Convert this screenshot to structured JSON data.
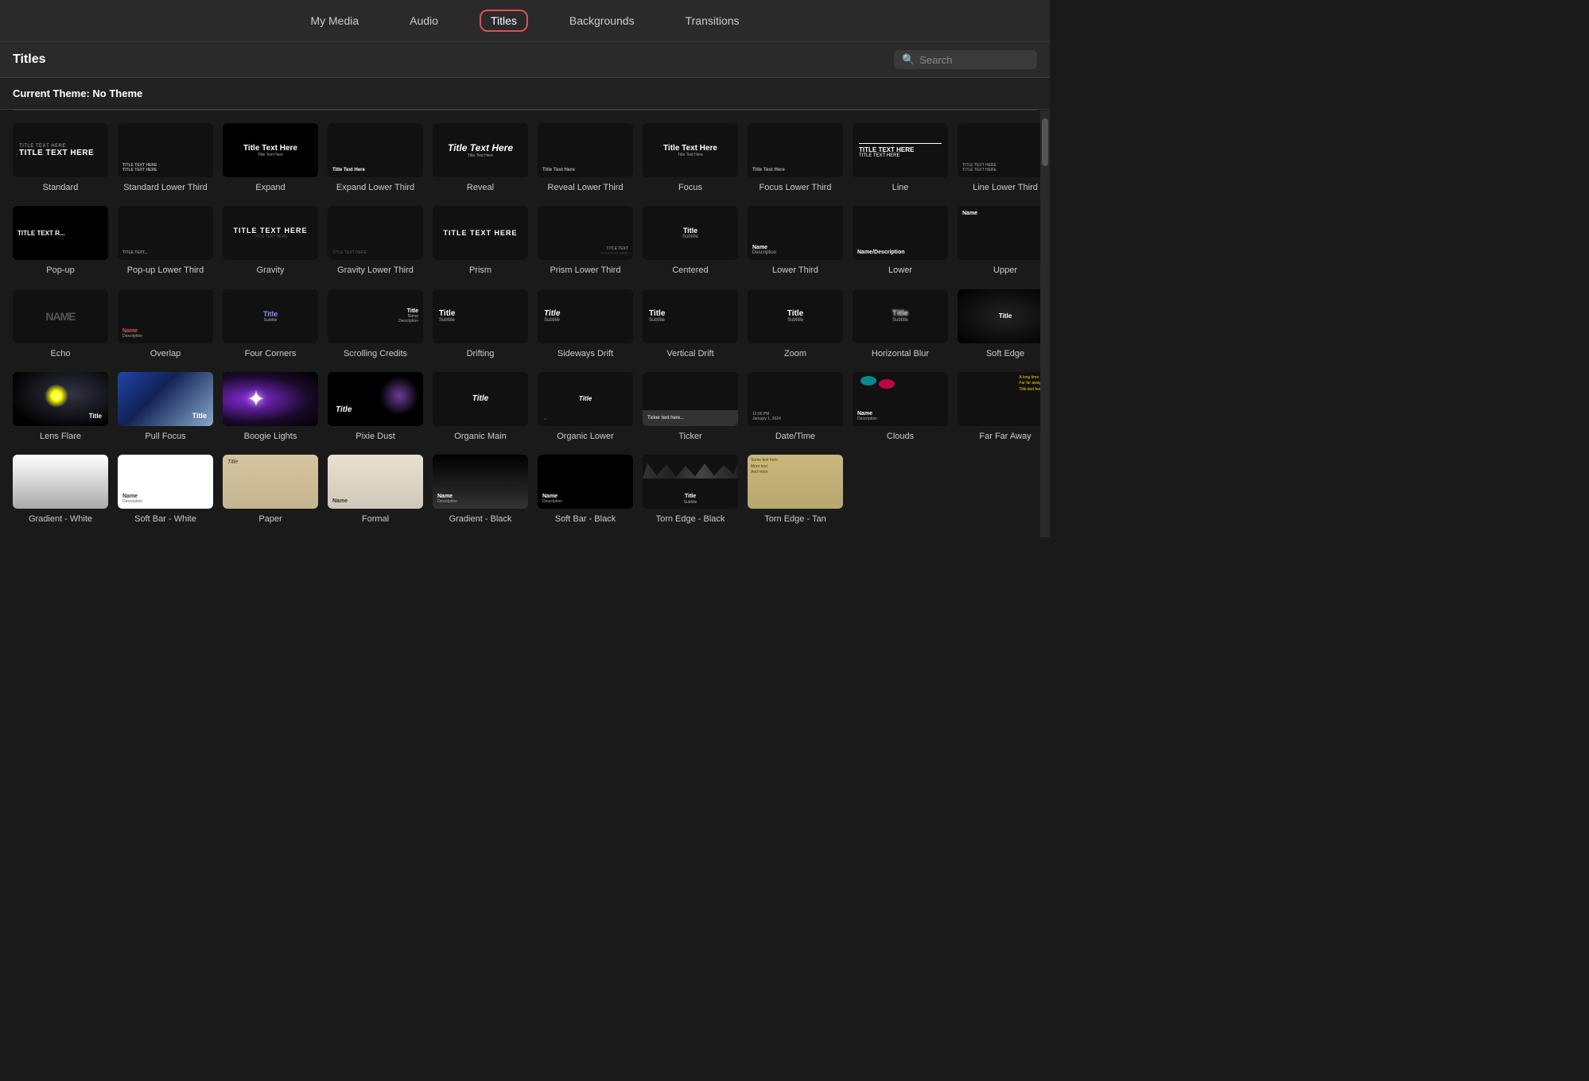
{
  "nav": {
    "items": [
      {
        "label": "My Media",
        "active": false
      },
      {
        "label": "Audio",
        "active": false
      },
      {
        "label": "Titles",
        "active": true
      },
      {
        "label": "Backgrounds",
        "active": false
      },
      {
        "label": "Transitions",
        "active": false
      }
    ]
  },
  "header": {
    "title": "Titles",
    "search_placeholder": "Search"
  },
  "theme_banner": "Current Theme: No Theme",
  "items": [
    {
      "label": "Standard",
      "thumb_type": "standard"
    },
    {
      "label": "Standard Lower Third",
      "thumb_type": "standard_lower"
    },
    {
      "label": "Expand",
      "thumb_type": "expand"
    },
    {
      "label": "Expand Lower Third",
      "thumb_type": "expand_lower"
    },
    {
      "label": "Reveal",
      "thumb_type": "reveal"
    },
    {
      "label": "Reveal Lower Third",
      "thumb_type": "reveal_lower"
    },
    {
      "label": "Focus",
      "thumb_type": "focus"
    },
    {
      "label": "Focus Lower Third",
      "thumb_type": "focus_lower"
    },
    {
      "label": "Line",
      "thumb_type": "line"
    },
    {
      "label": "Line Lower Third",
      "thumb_type": "line_lower"
    },
    {
      "label": "Pop-up",
      "thumb_type": "popup"
    },
    {
      "label": "Pop-up Lower Third",
      "thumb_type": "popup_lower"
    },
    {
      "label": "Gravity",
      "thumb_type": "gravity"
    },
    {
      "label": "Gravity Lower Third",
      "thumb_type": "gravity_lower"
    },
    {
      "label": "Prism",
      "thumb_type": "prism"
    },
    {
      "label": "Prism Lower Third",
      "thumb_type": "prism_lower"
    },
    {
      "label": "Centered",
      "thumb_type": "centered"
    },
    {
      "label": "Lower Third",
      "thumb_type": "lower_third"
    },
    {
      "label": "Lower",
      "thumb_type": "lower"
    },
    {
      "label": "Upper",
      "thumb_type": "upper"
    },
    {
      "label": "Echo",
      "thumb_type": "echo"
    },
    {
      "label": "Overlap",
      "thumb_type": "overlap"
    },
    {
      "label": "Four Corners",
      "thumb_type": "fourcorners"
    },
    {
      "label": "Scrolling Credits",
      "thumb_type": "scrolling"
    },
    {
      "label": "Drifting",
      "thumb_type": "drifting"
    },
    {
      "label": "Sideways Drift",
      "thumb_type": "sideways_drift"
    },
    {
      "label": "Vertical Drift",
      "thumb_type": "vertical_drift"
    },
    {
      "label": "Zoom",
      "thumb_type": "zoom"
    },
    {
      "label": "Horizontal Blur",
      "thumb_type": "hblur"
    },
    {
      "label": "Soft Edge",
      "thumb_type": "softedge"
    },
    {
      "label": "Lens Flare",
      "thumb_type": "lensflare"
    },
    {
      "label": "Pull Focus",
      "thumb_type": "pullfocus"
    },
    {
      "label": "Boogie Lights",
      "thumb_type": "boogie"
    },
    {
      "label": "Pixie Dust",
      "thumb_type": "pixie"
    },
    {
      "label": "Organic Main",
      "thumb_type": "organic_main"
    },
    {
      "label": "Organic Lower",
      "thumb_type": "organic_lower"
    },
    {
      "label": "Ticker",
      "thumb_type": "ticker"
    },
    {
      "label": "Date/Time",
      "thumb_type": "datetime"
    },
    {
      "label": "Clouds",
      "thumb_type": "clouds"
    },
    {
      "label": "Far Far Away",
      "thumb_type": "farfaraway"
    },
    {
      "label": "Gradient - White",
      "thumb_type": "gradient_white"
    },
    {
      "label": "Soft Bar - White",
      "thumb_type": "softbar_white"
    },
    {
      "label": "Paper",
      "thumb_type": "paper"
    },
    {
      "label": "Formal",
      "thumb_type": "formal"
    },
    {
      "label": "Gradient - Black",
      "thumb_type": "gradient_black"
    },
    {
      "label": "Soft Bar - Black",
      "thumb_type": "softbar_black"
    },
    {
      "label": "Torn Edge - Black",
      "thumb_type": "torn_black"
    },
    {
      "label": "Torn Edge - Tan",
      "thumb_type": "torn_tan"
    }
  ]
}
